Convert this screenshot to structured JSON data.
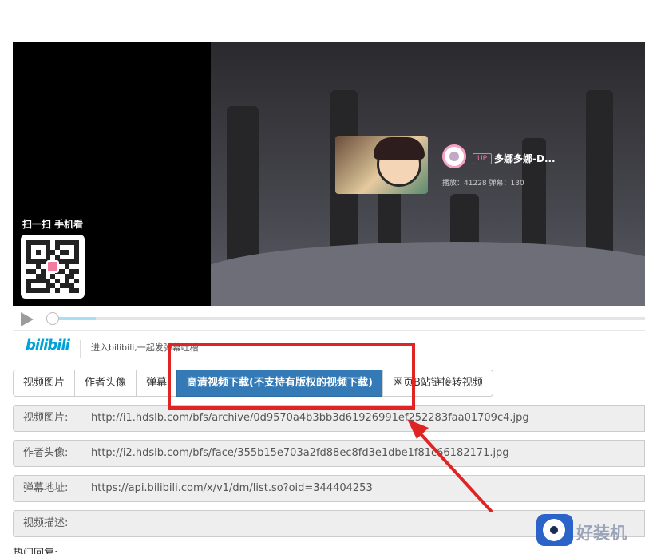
{
  "player": {
    "qr_title": "扫一扫 手机看",
    "up_badge": "UP",
    "up_name": "多娜多娜-D...",
    "stats": "播放：41228    弹幕：130",
    "progress_fraction": 0.08
  },
  "bilibili_bar": {
    "logo": "bilibili",
    "text": "进入bilibili,一起发弹幕吐槽"
  },
  "tabs": [
    {
      "label": "视频图片"
    },
    {
      "label": "作者头像"
    },
    {
      "label": "弹幕"
    },
    {
      "label": "高清视频下载(不支持有版权的视频下载)"
    },
    {
      "label": "网页B站链接转视频"
    }
  ],
  "fields": [
    {
      "label": "视频图片:",
      "value": "http://i1.hdslb.com/bfs/archive/0d9570a4b3bb3d61926991ef252283faa01709c4.jpg"
    },
    {
      "label": "作者头像:",
      "value": "http://i2.hdslb.com/bfs/face/355b15e703a2fd88ec8fd3e1dbe1f81c66182171.jpg"
    },
    {
      "label": "弹幕地址:",
      "value": "https://api.bilibili.com/x/v1/dm/list.so?oid=344404253"
    },
    {
      "label": "视频描述:",
      "value": ""
    }
  ],
  "hot_reply": "热门回复:",
  "watermark": "好装机",
  "colors": {
    "accent": "#337ab7",
    "annotation": "#e02424",
    "bilibili": "#00a1d6",
    "up_pink": "#fb7299"
  }
}
